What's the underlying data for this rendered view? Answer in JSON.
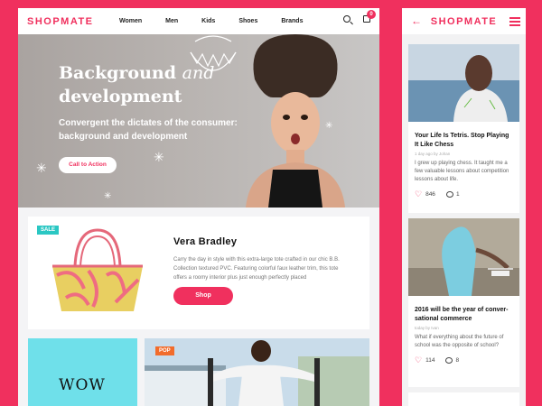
{
  "desktop": {
    "logo": "SHOPMATE",
    "nav": [
      "Women",
      "Men",
      "Kids",
      "Shoes",
      "Brands"
    ],
    "cart_count": "0",
    "hero": {
      "title_part1": "Background",
      "title_part2": "and",
      "title_part3": "development",
      "subtitle": "Convergent the dictates of the consumer: background and development",
      "cta": "Call to Action"
    },
    "product": {
      "badge": "SALE",
      "title": "Vera Bradley",
      "description": "Carry the day in style with this extra-large tote crafted in our chic B.B. Collection textured PVC. Featuring colorful faux leather trim, this tote offers a roomy interior plus just enough perfectly placed",
      "button": "Shop"
    },
    "card_wow": {
      "title": "WOW"
    },
    "card_pop": {
      "badge": "POP"
    }
  },
  "mobile": {
    "logo": "SHOPMATE",
    "posts": [
      {
        "title": "Your Life Is Tetris. Stop Playing It Like Chess",
        "meta": "1 day ago by Johan",
        "desc": "I grew up playing chess. It taught me a few valuable lessons about competition lessons about life.",
        "likes": "846",
        "comments": "1"
      },
      {
        "title": "2016 will be the year of conver-sational commerce",
        "meta": "today by Ivan",
        "desc": "What if everything about the future of school was the opposite of school?",
        "likes": "114",
        "comments": "8"
      }
    ]
  },
  "colors": {
    "accent": "#f0305e",
    "teal": "#2ac7c3",
    "orange": "#f26c2b",
    "cyan": "#6fe0ea"
  }
}
